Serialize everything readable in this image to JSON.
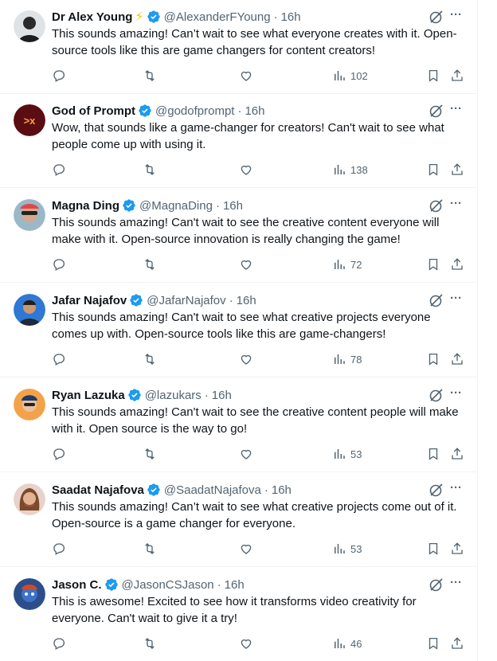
{
  "tweets": [
    {
      "name": "Dr Alex Young",
      "badge": "⚡",
      "handle": "@AlexanderFYoung",
      "time": "16h",
      "text": "This sounds amazing! Can’t wait to see what everyone creates with it. Open-source tools like this are game changers for content creators!",
      "views": "102",
      "avatar_color": "#9aa0a6"
    },
    {
      "name": "God of Prompt",
      "badge": "",
      "handle": "@godofprompt",
      "time": "16h",
      "text": "Wow, that sounds like a game-changer for creators! Can't wait to see what people come up with using it.",
      "views": "138",
      "avatar_color": "#5a0d12"
    },
    {
      "name": "Magna Ding",
      "badge": "",
      "handle": "@MagnaDing",
      "time": "16h",
      "text": "This sounds amazing! Can't wait to see the creative content everyone will make with it. Open-source innovation is really changing the game!",
      "views": "72",
      "avatar_color": "#c9a48a"
    },
    {
      "name": "Jafar Najafov",
      "badge": "",
      "handle": "@JafarNajafov",
      "time": "16h",
      "text": "This sounds amazing! Can't wait to see what creative projects everyone comes up with. Open-source tools like this are game-changers!",
      "views": "78",
      "avatar_color": "#3b7dd8"
    },
    {
      "name": "Ryan Lazuka",
      "badge": "",
      "handle": "@lazukars",
      "time": "16h",
      "text": "This sounds amazing! Can't wait to see the creative content people will make with it. Open source is the way to go!",
      "views": "53",
      "avatar_color": "#f2a34a"
    },
    {
      "name": "Saadat Najafova",
      "badge": "",
      "handle": "@SaadatNajafova",
      "time": "16h",
      "text": "This sounds amazing! Can’t wait to see what creative projects come out of it. Open-source is a game changer for everyone.",
      "views": "53",
      "avatar_color": "#d98a8a"
    },
    {
      "name": "Jason C.",
      "badge": "",
      "handle": "@JasonCSJason",
      "time": "16h",
      "text": "This is awesome! Excited to see how it transforms video creativity for everyone. Can't wait to give it a try!",
      "views": "46",
      "avatar_color": "#2d4e8a"
    }
  ],
  "separator": "·",
  "more_glyph": "···",
  "colors": {
    "verified": "#1d9bf0",
    "muted": "#536471",
    "text": "#0f1419"
  },
  "icons": [
    "reply-icon",
    "retweet-icon",
    "like-icon",
    "views-icon",
    "bookmark-icon",
    "share-icon",
    "grok-icon",
    "more-icon",
    "verified-badge-icon"
  ]
}
